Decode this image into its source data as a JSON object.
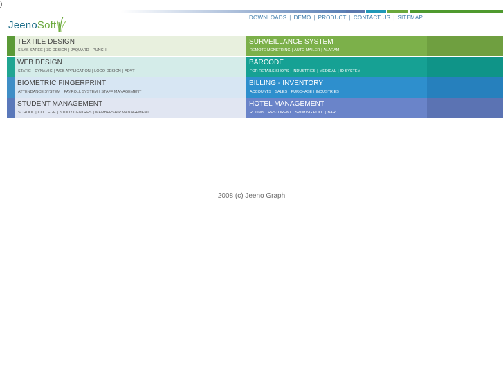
{
  "stray_char": ")",
  "logo": {
    "part1": "Jeeno",
    "part2": "Soft"
  },
  "nav": [
    "DOWNLOADS",
    "DEMO",
    "PRODUCT",
    "CONTACT US",
    "SITEMAP"
  ],
  "colors": {
    "topbar": [
      "#5b78ad",
      "#1e98b8",
      "#6aa83c",
      "#4f9a2f"
    ],
    "left_bars": [
      "#5b9a37",
      "#20a592",
      "#3f8ec6",
      "#5a78ba"
    ],
    "left_bg": [
      "#e8f0de",
      "#d4ece9",
      "#d7e6f3",
      "#e1e6f2"
    ],
    "right_bg": [
      "#7cb04a",
      "#16a194",
      "#2e8fcd",
      "#6a84c9"
    ],
    "right_tail": [
      "#6f9f40",
      "#0f9488",
      "#2680bd",
      "#5b73b3"
    ]
  },
  "products": {
    "left": [
      {
        "title": "TEXTILE DESIGN",
        "subs": [
          "SILKS SAREE",
          "3D DESIGN",
          "JAQUARD",
          "PUNCH"
        ]
      },
      {
        "title": "WEB DESIGN",
        "subs": [
          "STATIC",
          "DYNAMIC",
          "WEB APPLICATION",
          "LOGO DESIGN",
          "ADVT"
        ]
      },
      {
        "title": "BIOMETRIC FINGERPRINT",
        "subs": [
          "ATTENDANCE SYSTEM",
          "PAYROLL SYSTEM",
          "STAFF MANAGEMENT"
        ]
      },
      {
        "title": "STUDENT MANAGEMENT",
        "subs": [
          "SCHOOL",
          "COLLEGE",
          "STUDY CENTRES",
          "MEMBERSHIP MANAGEMENT"
        ]
      }
    ],
    "right": [
      {
        "title": "SURVEILLANCE SYSTEM",
        "subs": [
          "REMOTE MONETRING",
          "AUTO MAILER",
          "ALARAM"
        ]
      },
      {
        "title": "BARCODE",
        "subs": [
          "FOR RETAILS SHOPS",
          "INDUSTRIES",
          "MEDICAL",
          "ID SYSTEM"
        ]
      },
      {
        "title": "BILLING - INVENTORY",
        "subs": [
          "ACCOUNTS",
          "SALES",
          "PURCHASE",
          "INDUSTRIES"
        ]
      },
      {
        "title": "HOTEL MANAGEMENT",
        "subs": [
          "ROOMS",
          "RESTORENT",
          "SWIMING POOL",
          "BAR"
        ]
      }
    ]
  },
  "footer": "2008 (c) Jeeno Graph"
}
